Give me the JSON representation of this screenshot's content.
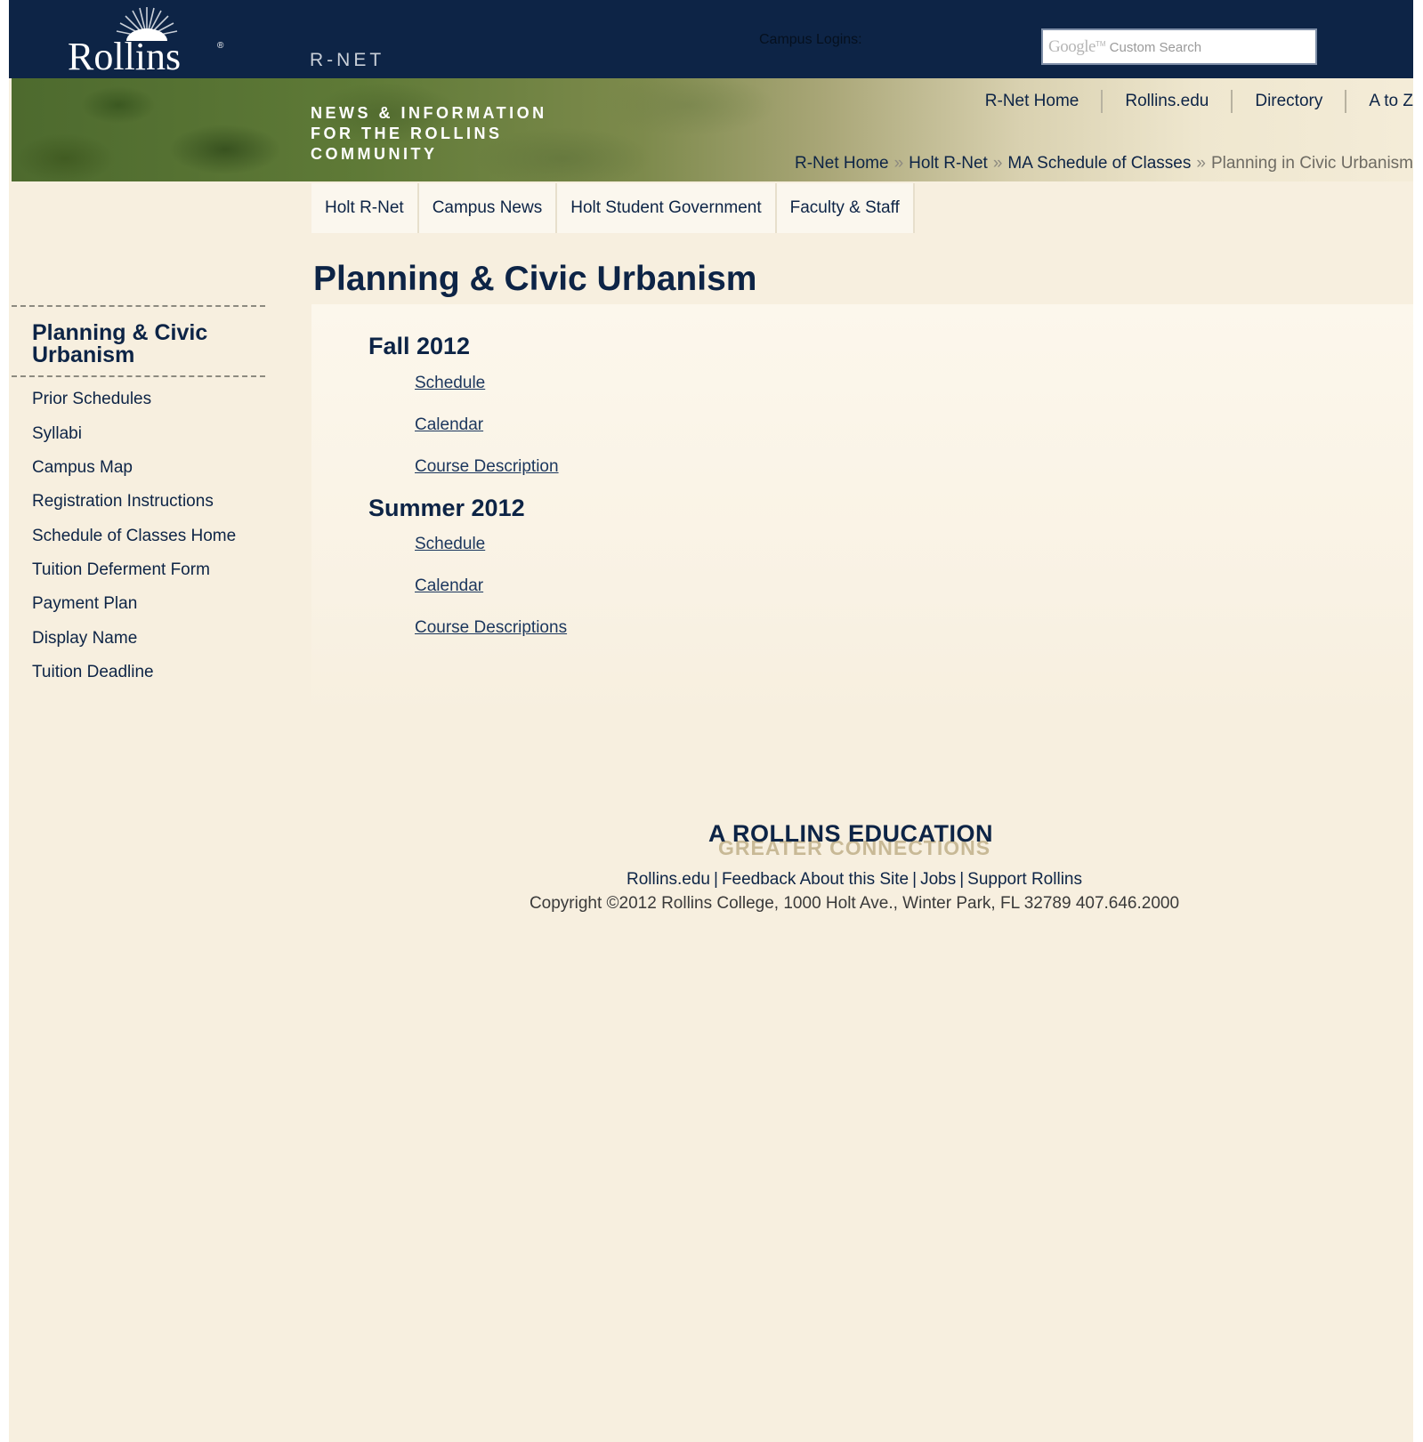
{
  "header": {
    "logo_text": "Rollins",
    "site_name": "R-NET",
    "campus_logins_label": "Campus Logins:",
    "search": {
      "brand": "Google",
      "trademark": "TM",
      "placeholder": "Custom Search"
    }
  },
  "banner": {
    "tagline": [
      "NEWS & INFORMATION",
      "FOR THE ROLLINS",
      "COMMUNITY"
    ]
  },
  "top_nav": [
    "R-Net Home",
    "Rollins.edu",
    "Directory",
    "A to Z"
  ],
  "breadcrumb": {
    "links": [
      "R-Net Home",
      "Holt R-Net",
      "MA Schedule of Classes"
    ],
    "separator": "»",
    "current": "Planning in Civic Urbanism"
  },
  "tabs": [
    "Holt R-Net",
    "Campus News",
    "Holt Student Government",
    "Faculty & Staff"
  ],
  "page_title": "Planning & Civic Urbanism",
  "terms": [
    {
      "title": "Fall 2012",
      "links": [
        "Schedule",
        "Calendar",
        "Course Description"
      ]
    },
    {
      "title": "Summer 2012",
      "links": [
        "Schedule",
        "Calendar",
        "Course Descriptions"
      ]
    }
  ],
  "sidebar": {
    "title": "Planning & Civic Urbanism",
    "items": [
      "Prior Schedules",
      "Syllabi",
      "Campus Map",
      "Registration Instructions",
      "Schedule of Classes Home",
      "Tuition Deferment Form",
      "Payment Plan",
      "Display Name",
      "Tuition Deadline"
    ]
  },
  "footer": {
    "logo_line1": "A ROLLINS EDUCATION",
    "logo_line2": "GREATER CONNECTIONS",
    "links": [
      "Rollins.edu",
      "Feedback About this Site",
      "Jobs",
      "Support Rollins"
    ],
    "link_separator": "|",
    "copyright": "Copyright ©2012 Rollins College, 1000 Holt Ave., Winter Park, FL 32789  407.646.2000"
  }
}
